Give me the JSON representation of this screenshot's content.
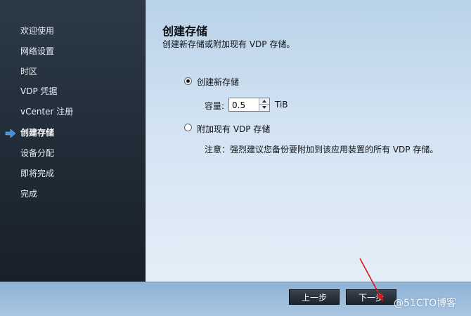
{
  "sidebar": {
    "items": [
      {
        "label": "欢迎使用",
        "active": false
      },
      {
        "label": "网络设置",
        "active": false
      },
      {
        "label": "时区",
        "active": false
      },
      {
        "label": "VDP 凭据",
        "active": false
      },
      {
        "label": "vCenter 注册",
        "active": false
      },
      {
        "label": "创建存储",
        "active": true
      },
      {
        "label": "设备分配",
        "active": false
      },
      {
        "label": "即将完成",
        "active": false
      },
      {
        "label": "完成",
        "active": false
      }
    ],
    "active_indicator_icon": "arrow-right-icon"
  },
  "main": {
    "title": "创建存储",
    "subtitle": "创建新存储或附加现有 VDP 存储。",
    "option_create": {
      "label": "创建新存储",
      "selected": true
    },
    "capacity": {
      "label": "容量:",
      "value": "0.5",
      "unit": "TiB"
    },
    "option_attach": {
      "label": "附加现有 VDP 存储",
      "selected": false
    },
    "note": "注意：强烈建议您备份要附加到该应用装置的所有 VDP 存储。"
  },
  "footer": {
    "back_label": "上一步",
    "next_label": "下一步"
  },
  "watermark": "@51CTO博客",
  "colors": {
    "sidebar_bg": "#1f2a35",
    "main_bg": "#d3e3f2",
    "button_bg": "#1c232b",
    "accent_arrow": "#3b8fe0",
    "annotation_red": "#d81818"
  }
}
